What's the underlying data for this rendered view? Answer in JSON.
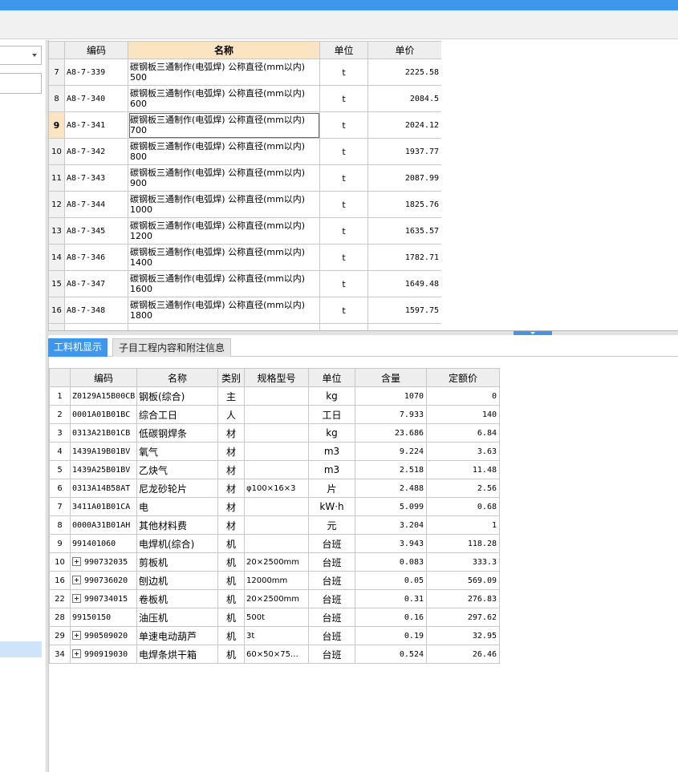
{
  "upper_table": {
    "headers": {
      "code": "编码",
      "name": "名称",
      "unit": "单位",
      "price": "单价"
    },
    "rows": [
      {
        "rn": "7",
        "code": "A8-7-339",
        "name_line1": "碳钢板三通制作(电弧焊) 公称直径(mm以内)",
        "name_line2": "500",
        "unit": "t",
        "price": "2225.58"
      },
      {
        "rn": "8",
        "code": "A8-7-340",
        "name_line1": "碳钢板三通制作(电弧焊) 公称直径(mm以内)",
        "name_line2": "600",
        "unit": "t",
        "price": "2084.5"
      },
      {
        "rn": "9",
        "code": "A8-7-341",
        "name_line1": "碳钢板三通制作(电弧焊) 公称直径(mm以内)",
        "name_line2": "700",
        "unit": "t",
        "price": "2024.12"
      },
      {
        "rn": "10",
        "code": "A8-7-342",
        "name_line1": "碳钢板三通制作(电弧焊) 公称直径(mm以内)",
        "name_line2": "800",
        "unit": "t",
        "price": "1937.77"
      },
      {
        "rn": "11",
        "code": "A8-7-343",
        "name_line1": "碳钢板三通制作(电弧焊) 公称直径(mm以内)",
        "name_line2": "900",
        "unit": "t",
        "price": "2087.99"
      },
      {
        "rn": "12",
        "code": "A8-7-344",
        "name_line1": "碳钢板三通制作(电弧焊) 公称直径(mm以内)",
        "name_line2": "1000",
        "unit": "t",
        "price": "1825.76"
      },
      {
        "rn": "13",
        "code": "A8-7-345",
        "name_line1": "碳钢板三通制作(电弧焊) 公称直径(mm以内)",
        "name_line2": "1200",
        "unit": "t",
        "price": "1635.57"
      },
      {
        "rn": "14",
        "code": "A8-7-346",
        "name_line1": "碳钢板三通制作(电弧焊) 公称直径(mm以内)",
        "name_line2": "1400",
        "unit": "t",
        "price": "1782.71"
      },
      {
        "rn": "15",
        "code": "A8-7-347",
        "name_line1": "碳钢板三通制作(电弧焊) 公称直径(mm以内)",
        "name_line2": "1600",
        "unit": "t",
        "price": "1649.48"
      },
      {
        "rn": "16",
        "code": "A8-7-348",
        "name_line1": "碳钢板三通制作(电弧焊) 公称直径(mm以内)",
        "name_line2": "1800",
        "unit": "t",
        "price": "1597.75"
      },
      {
        "rn": "",
        "code": "",
        "name_line1": "碳钢板三通制作(电弧焊) 公称直径(mm以内)",
        "name_line2": "",
        "unit": "",
        "price": ""
      }
    ]
  },
  "tabs": {
    "labor_material_machine": "工料机显示",
    "sub_item_content": "子目工程内容和附注信息"
  },
  "lower_table": {
    "headers": {
      "code": "编码",
      "name": "名称",
      "category": "类别",
      "spec": "规格型号",
      "unit": "单位",
      "qty": "含量",
      "price": "定额价"
    },
    "rows": [
      {
        "rn": "1",
        "code": "Z0129A15B00CB",
        "name": "钢板(综合)",
        "category": "主",
        "spec": "",
        "unit": "kg",
        "qty": "1070",
        "price": "0"
      },
      {
        "rn": "2",
        "code": "0001A01B01BC",
        "name": "综合工日",
        "category": "人",
        "spec": "",
        "unit": "工日",
        "qty": "7.933",
        "price": "140"
      },
      {
        "rn": "3",
        "code": "0313A21B01CB",
        "name": "低碳钢焊条",
        "category": "材",
        "spec": "",
        "unit": "kg",
        "qty": "23.686",
        "price": "6.84"
      },
      {
        "rn": "4",
        "code": "1439A19B01BV",
        "name": "氧气",
        "category": "材",
        "spec": "",
        "unit": "m3",
        "qty": "9.224",
        "price": "3.63"
      },
      {
        "rn": "5",
        "code": "1439A25B01BV",
        "name": "乙炔气",
        "category": "材",
        "spec": "",
        "unit": "m3",
        "qty": "2.518",
        "price": "11.48"
      },
      {
        "rn": "6",
        "code": "0313A14B58AT",
        "name": "尼龙砂轮片",
        "category": "材",
        "spec": "φ100×16×3",
        "unit": "片",
        "qty": "2.488",
        "price": "2.56"
      },
      {
        "rn": "7",
        "code": "3411A01B01CA",
        "name": "电",
        "category": "材",
        "spec": "",
        "unit": "kW·h",
        "qty": "5.099",
        "price": "0.68"
      },
      {
        "rn": "8",
        "code": "0000A31B01AH",
        "name": "其他材料费",
        "category": "材",
        "spec": "",
        "unit": "元",
        "qty": "3.204",
        "price": "1"
      },
      {
        "rn": "9",
        "code": "991401060",
        "name": "电焊机(综合)",
        "category": "机",
        "spec": "",
        "unit": "台班",
        "qty": "3.943",
        "price": "118.28"
      },
      {
        "rn": "10",
        "code": "990732035",
        "name": "剪板机",
        "category": "机",
        "spec": "20×2500mm",
        "unit": "台班",
        "qty": "0.083",
        "price": "333.3"
      },
      {
        "rn": "16",
        "code": "990736020",
        "name": "刨边机",
        "category": "机",
        "spec": "12000mm",
        "unit": "台班",
        "qty": "0.05",
        "price": "569.09"
      },
      {
        "rn": "22",
        "code": "990734015",
        "name": "卷板机",
        "category": "机",
        "spec": "20×2500mm",
        "unit": "台班",
        "qty": "0.31",
        "price": "276.83"
      },
      {
        "rn": "28",
        "code": "99150150",
        "name": "油压机",
        "category": "机",
        "spec": "500t",
        "unit": "台班",
        "qty": "0.16",
        "price": "297.62"
      },
      {
        "rn": "29",
        "code": "990509020",
        "name": "单速电动葫芦",
        "category": "机",
        "spec": "3t",
        "unit": "台班",
        "qty": "0.19",
        "price": "32.95"
      },
      {
        "rn": "34",
        "code": "990919030",
        "name": "电焊条烘干箱",
        "category": "机",
        "spec": "60×50×75…",
        "unit": "台班",
        "qty": "0.524",
        "price": "26.46"
      }
    ]
  },
  "icons": {
    "expand": "plus-box-icon",
    "dropdown": "chevron-down-icon"
  },
  "colors": {
    "accent": "#3f97ec",
    "selected_header": "#fbe4c2",
    "selected_row": "#cfe4f9"
  }
}
